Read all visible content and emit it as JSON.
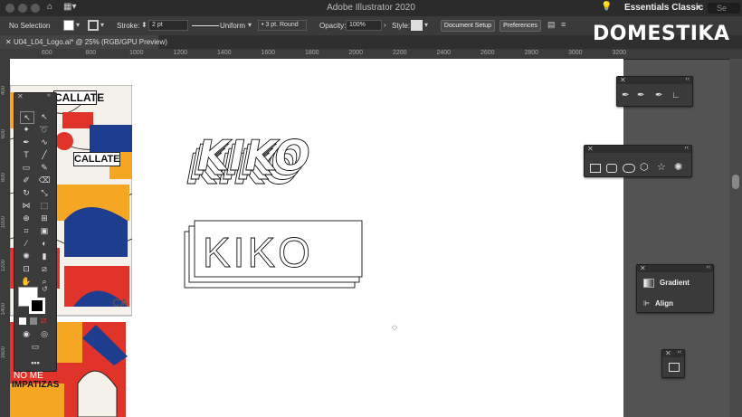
{
  "app": {
    "title": "Adobe Illustrator 2020",
    "workspace": "Essentials Classic",
    "search_placeholder": "Se"
  },
  "control_bar": {
    "selection": "No Selection",
    "stroke_label": "Stroke:",
    "stroke_value": "2 pt",
    "profile": "Uniform",
    "brush": "3 pt. Round",
    "opacity_label": "Opacity:",
    "opacity_value": "100%",
    "style_label": "Style:",
    "document_setup": "Document Setup",
    "preferences": "Preferences"
  },
  "tab": {
    "label": "U04_L04_Logo.ai* @ 25% (RGB/GPU Preview)"
  },
  "brand": "DOMESTIKA",
  "ruler_h": [
    "600",
    "800",
    "1000",
    "1200",
    "1400",
    "1600",
    "1800",
    "2000",
    "2200",
    "2400",
    "2600",
    "2800",
    "3000",
    "3200"
  ],
  "ruler_v": [
    "400",
    "600",
    "800",
    "1000",
    "1200",
    "1400",
    "1600"
  ],
  "artwork": {
    "logo_top": "KIKO",
    "logo_bottom": "KIKO",
    "collage_texts": [
      "CALLATE",
      "CALLATE",
      "NO ME",
      "IMPATIZAS",
      "CA"
    ]
  },
  "panels": {
    "gradient_label": "Gradient",
    "align_label": "Align"
  },
  "colors": {
    "accent_orange": "#f5a623",
    "accent_red": "#e0342b",
    "accent_blue": "#1f3d8f",
    "panel_bg": "#3a3a3a"
  }
}
